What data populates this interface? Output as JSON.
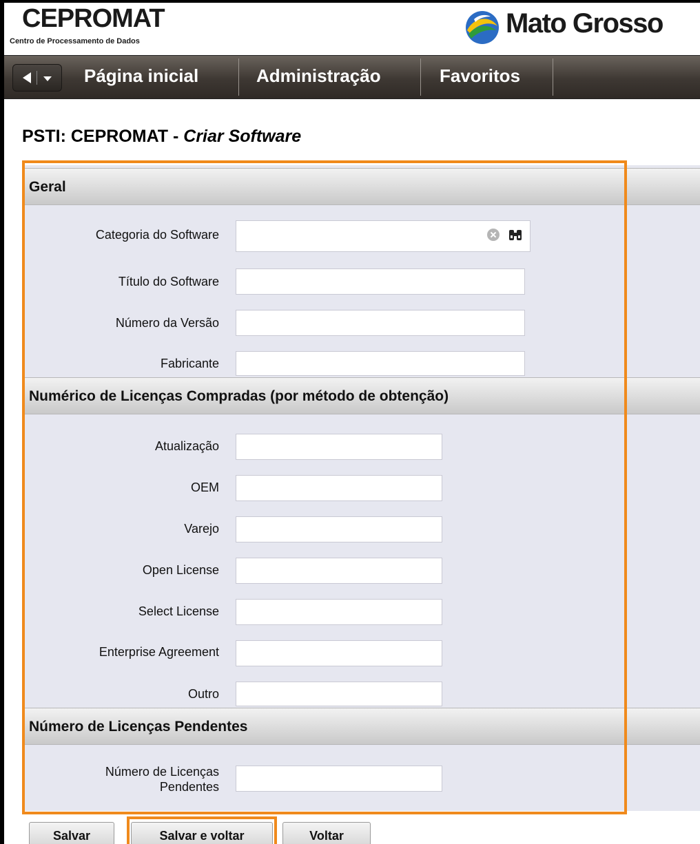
{
  "header": {
    "brand_title": "CEPROMAT",
    "brand_subtitle": "Centro de Processamento de Dados",
    "state_name": "Mato Grosso"
  },
  "nav": {
    "items": [
      {
        "label": "Página inicial"
      },
      {
        "label": "Administração"
      },
      {
        "label": "Favoritos"
      }
    ]
  },
  "page": {
    "title_prefix": "PSTI: CEPROMAT - ",
    "title_action": "Criar Software"
  },
  "sections": {
    "geral": {
      "title": "Geral",
      "fields": [
        {
          "label": "Categoria do Software",
          "value": ""
        },
        {
          "label": "Título do Software",
          "value": ""
        },
        {
          "label": "Número da Versão",
          "value": ""
        },
        {
          "label": "Fabricante",
          "value": ""
        }
      ]
    },
    "licencas": {
      "title": "Numérico de Licenças Compradas (por método de obtenção)",
      "fields": [
        {
          "label": "Atualização",
          "value": ""
        },
        {
          "label": "OEM",
          "value": ""
        },
        {
          "label": "Varejo",
          "value": ""
        },
        {
          "label": "Open License",
          "value": ""
        },
        {
          "label": "Select License",
          "value": ""
        },
        {
          "label": "Enterprise Agreement",
          "value": ""
        },
        {
          "label": "Outro",
          "value": ""
        }
      ]
    },
    "pendentes": {
      "title": "Número de Licenças Pendentes",
      "fields": [
        {
          "label_line1": "Número de Licenças",
          "label_line2": "Pendentes",
          "value": ""
        }
      ]
    }
  },
  "buttons": {
    "save": "Salvar",
    "save_and_back": "Salvar e voltar",
    "back": "Voltar"
  },
  "icons": {
    "clear": "clear-icon",
    "lookup": "binoculars-icon",
    "logo": "mato-grosso-logo"
  },
  "colors": {
    "highlight": "#f08a1c",
    "nav_bg": "#3e3833",
    "form_bg": "#e6e7f0"
  }
}
